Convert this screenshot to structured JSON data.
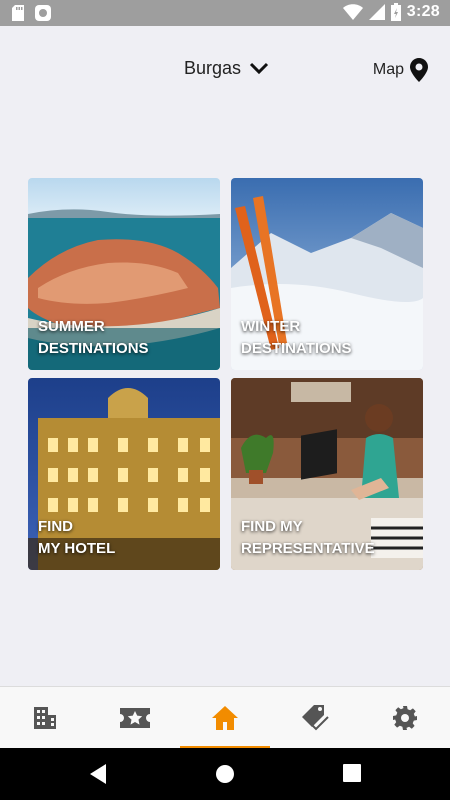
{
  "status_bar": {
    "time": "3:28",
    "icons": [
      "sd-card-icon",
      "circle-icon",
      "wifi-icon",
      "signal-icon",
      "battery-icon"
    ]
  },
  "header": {
    "city": "Burgas",
    "map_label": "Map"
  },
  "tiles": [
    {
      "line1": "SUMMER",
      "line2": "DESTINATIONS",
      "image": "seaside-town-peninsula"
    },
    {
      "line1": "WINTER",
      "line2": "DESTINATIONS",
      "image": "skis-in-snow-mountains"
    },
    {
      "line1": "FIND",
      "line2": "MY HOTEL",
      "image": "illuminated-hotel-building"
    },
    {
      "line1": "FIND MY",
      "line2": "REPRESENTATIVE",
      "image": "woman-at-desk-with-laptop"
    }
  ],
  "bottom_nav": {
    "items": [
      {
        "icon": "hotel-building-icon",
        "active": false
      },
      {
        "icon": "ticket-star-icon",
        "active": false
      },
      {
        "icon": "home-icon",
        "active": true
      },
      {
        "icon": "tags-icon",
        "active": false
      },
      {
        "icon": "settings-gear-icon",
        "active": false
      }
    ],
    "active_color": "#f28c00",
    "inactive_color": "#555555"
  }
}
